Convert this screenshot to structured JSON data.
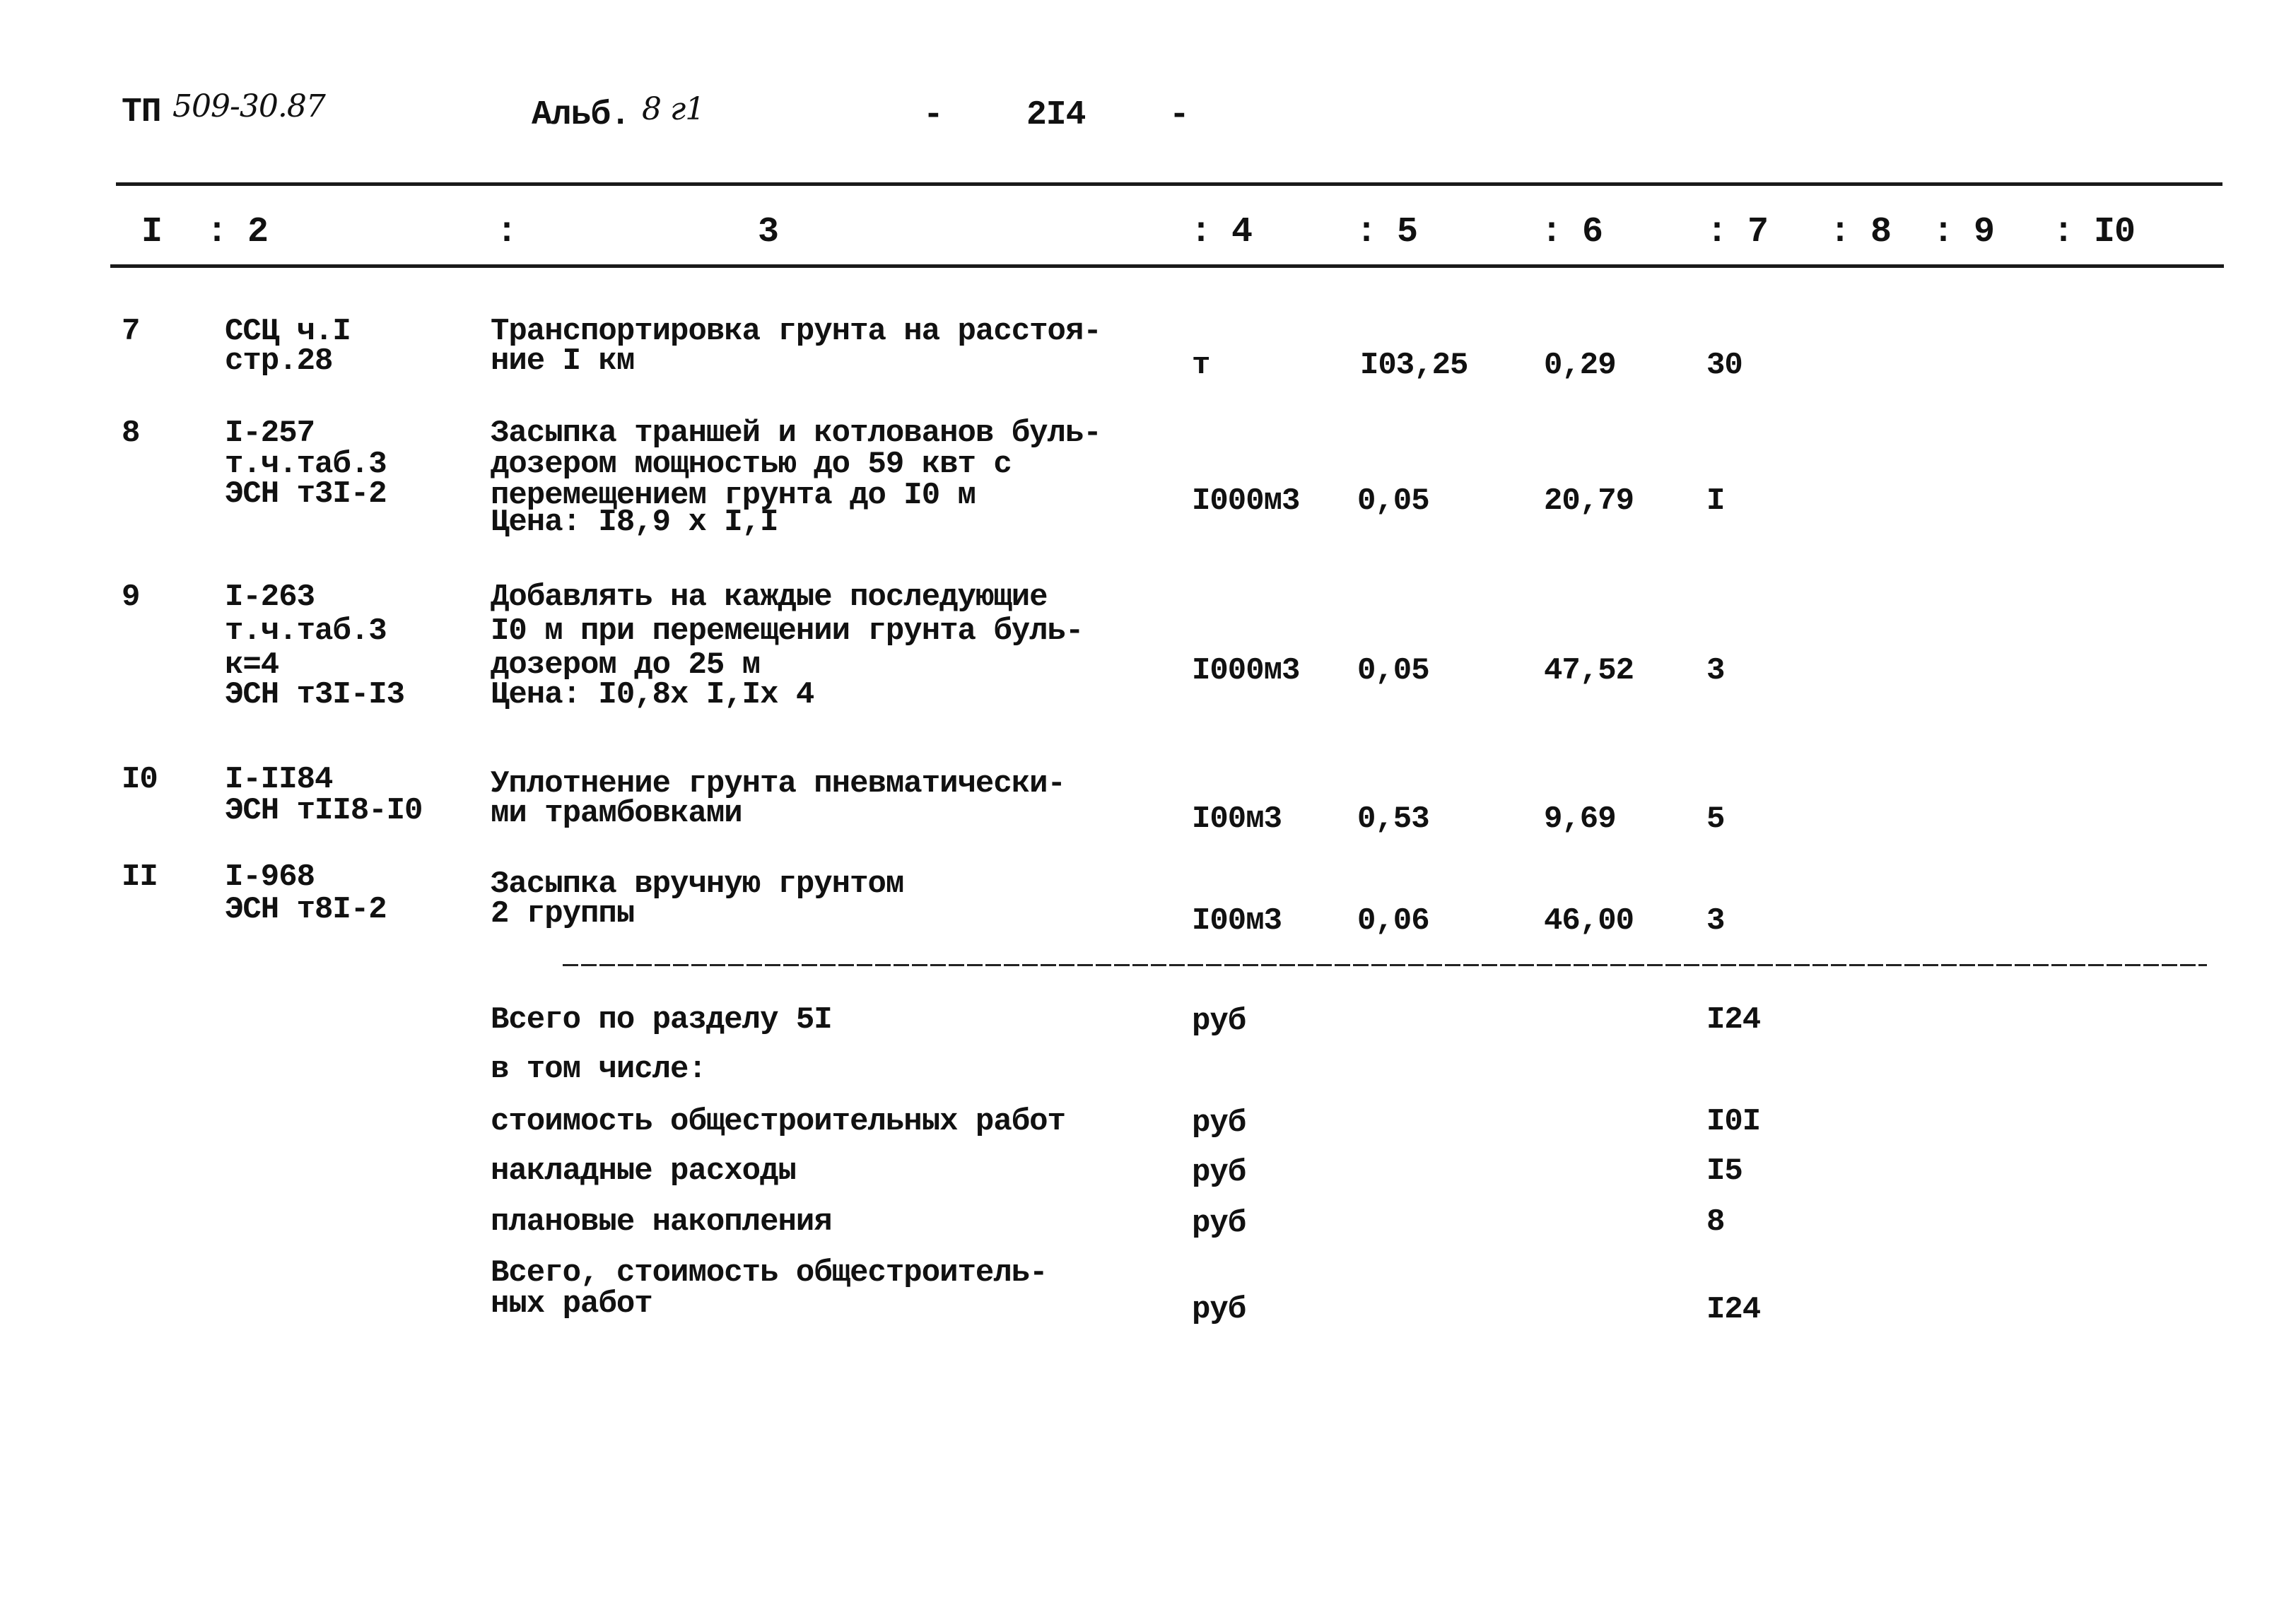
{
  "header": {
    "doc_code_prefix": "ТП",
    "doc_code_handwritten": "509-30.87",
    "album_label": "Альб.",
    "album_handwritten": "8 г1",
    "page_dash_left": "-",
    "page_number": "2I4",
    "page_dash_right": "-"
  },
  "columns": [
    {
      "label": "I"
    },
    {
      "label": ": 2"
    },
    {
      "label": ":"
    },
    {
      "label": "3"
    },
    {
      "label": ": 4"
    },
    {
      "label": ": 5"
    },
    {
      "label": ": 6"
    },
    {
      "label": ": 7"
    },
    {
      "label": ": 8"
    },
    {
      "label": ": 9"
    },
    {
      "label": ": I0"
    }
  ],
  "rows": [
    {
      "num": "7",
      "code": [
        "ССЦ ч.I",
        "стр.28"
      ],
      "desc": [
        "Транспортировка грунта на расстоя-",
        "ние I км"
      ],
      "unit": "т",
      "qty": "I03,25",
      "price": "0,29",
      "total": "30"
    },
    {
      "num": "8",
      "code": [
        "I-257",
        "т.ч.таб.3",
        "ЭСН т3I-2"
      ],
      "desc": [
        "Засыпка траншей и котлованов буль-",
        "дозером мощностью до 59 квт с",
        "перемещением грунта до I0 м",
        "Цена: I8,9 х I,I"
      ],
      "unit": "I000м3",
      "qty": "0,05",
      "price": "20,79",
      "total": "I"
    },
    {
      "num": "9",
      "code": [
        "I-263",
        "т.ч.таб.3",
        "к=4",
        "ЭСН т3I-I3"
      ],
      "desc": [
        "Добавлять на каждые последующие",
        "I0 м при перемещении грунта буль-",
        "дозером до 25 м",
        "Цена: I0,8х I,Iх 4"
      ],
      "unit": "I000м3",
      "qty": "0,05",
      "price": "47,52",
      "total": "3"
    },
    {
      "num": "I0",
      "code": [
        "I-II84",
        "ЭСН тII8-I0"
      ],
      "desc": [
        "Уплотнение грунта пневматически-",
        "ми трамбовками"
      ],
      "unit": "I00м3",
      "qty": "0,53",
      "price": "9,69",
      "total": "5"
    },
    {
      "num": "II",
      "code": [
        "I-968",
        "ЭСН т8I-2"
      ],
      "desc": [
        "Засыпка вручную грунтом",
        "2 группы"
      ],
      "unit": "I00м3",
      "qty": "0,06",
      "price": "46,00",
      "total": "3"
    }
  ],
  "summary": [
    {
      "label": [
        "Всего по разделу 5I"
      ],
      "unit": "руб",
      "total": "I24"
    },
    {
      "label": [
        "в том числе:"
      ],
      "unit": "",
      "total": ""
    },
    {
      "label": [
        "стоимость общестроительных работ"
      ],
      "unit": "руб",
      "total": "I0I"
    },
    {
      "label": [
        "накладные расходы"
      ],
      "unit": "руб",
      "total": "I5"
    },
    {
      "label": [
        "плановые накопления"
      ],
      "unit": "руб",
      "total": "8"
    },
    {
      "label": [
        "Всего, стоимость общестроитель-",
        "ных работ"
      ],
      "unit": "руб",
      "total": "I24"
    }
  ]
}
